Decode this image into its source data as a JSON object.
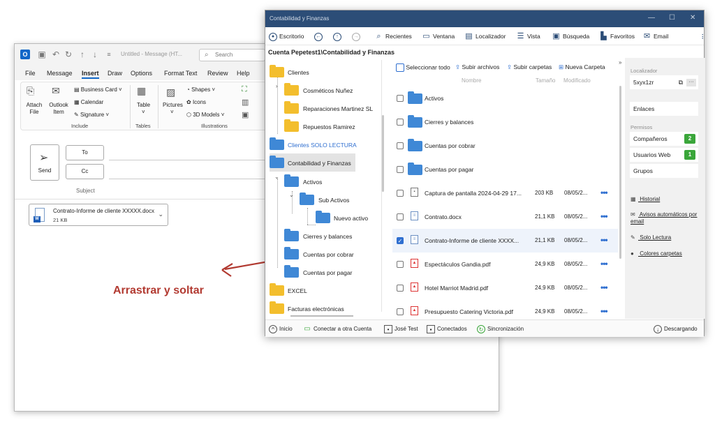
{
  "outlook": {
    "doc_title": "Untitled - Message (HT...",
    "search_placeholder": "Search",
    "menu": [
      "File",
      "Message",
      "Insert",
      "Draw",
      "Options",
      "Format Text",
      "Review",
      "Help"
    ],
    "ribbon": {
      "attach_file": "Attach File",
      "outlook_item": "Outlook Item",
      "business_card": "Business Card",
      "calendar": "Calendar",
      "signature": "Signature",
      "group_include": "Include",
      "table": "Table",
      "group_tables": "Tables",
      "pictures": "Pictures",
      "shapes": "Shapes",
      "icons": "Icons",
      "models_3d": "3D Models",
      "group_illustrations": "Illustrations"
    },
    "send": "Send",
    "to": "To",
    "cc": "Cc",
    "subject": "Subject",
    "attachment": {
      "name": "Contrato-Informe de cliente XXXXX.docx",
      "size": "21 KB"
    }
  },
  "drag_label": "Arrastrar y soltar",
  "app": {
    "title": "Contabilidad y Finanzas",
    "toolbar": {
      "escritorio": "Escritorio",
      "recientes": "Recientes",
      "ventana": "Ventana",
      "localizador": "Localizador",
      "vista": "Vista",
      "busqueda": "Búsqueda",
      "favoritos": "Favoritos",
      "email": "Email"
    },
    "path": "Cuenta Pepetest1\\Contabilidad y Finanzas",
    "tree": [
      {
        "label": "Clientes",
        "color": "yellow"
      },
      {
        "label": "Cosméticos Nuñez",
        "color": "yellow"
      },
      {
        "label": "Reparaciones Martinez SL",
        "color": "yellow"
      },
      {
        "label": "Repuestos Ramirez",
        "color": "yellow"
      },
      {
        "label": "Clientes SOLO LECTURA",
        "color": "blue"
      },
      {
        "label": "Contabilidad y Finanzas",
        "color": "blue"
      },
      {
        "label": "Activos",
        "color": "blue"
      },
      {
        "label": "Sub Activos",
        "color": "blue"
      },
      {
        "label": "Nuevo activo",
        "color": "blue"
      },
      {
        "label": "Cierres y balances",
        "color": "blue"
      },
      {
        "label": "Cuentas por cobrar",
        "color": "blue"
      },
      {
        "label": "Cuentas por pagar",
        "color": "blue"
      },
      {
        "label": "EXCEL",
        "color": "yellow"
      },
      {
        "label": "Facturas electrónicas",
        "color": "yellow"
      }
    ],
    "list_actions": {
      "select_all": "Seleccionar todo",
      "upload_files": "Subir archivos",
      "upload_folders": "Subir carpetas",
      "new_folder": "Nueva Carpeta"
    },
    "columns": {
      "name": "Nombre",
      "size": "Tamaño",
      "modified": "Modificado"
    },
    "files": [
      {
        "name": "Activos",
        "type": "folder",
        "size": "",
        "modified": ""
      },
      {
        "name": "Cierres y balances",
        "type": "folder",
        "size": "",
        "modified": ""
      },
      {
        "name": "Cuentas por cobrar",
        "type": "folder",
        "size": "",
        "modified": ""
      },
      {
        "name": "Cuentas por pagar",
        "type": "folder",
        "size": "",
        "modified": ""
      },
      {
        "name": "Captura de pantalla 2024-04-29 17...",
        "type": "img",
        "size": "203 KB",
        "modified": "08/05/2..."
      },
      {
        "name": "Contrato.docx",
        "type": "doc",
        "size": "21,1 KB",
        "modified": "08/05/2..."
      },
      {
        "name": "Contrato-Informe de cliente XXXX...",
        "type": "doc",
        "size": "21,1 KB",
        "modified": "08/05/2...",
        "selected": true
      },
      {
        "name": "Espectáculos Gandia.pdf",
        "type": "pdf",
        "size": "24,9 KB",
        "modified": "08/05/2..."
      },
      {
        "name": "Hotel Marriot Madrid.pdf",
        "type": "pdf",
        "size": "24,9 KB",
        "modified": "08/05/2..."
      },
      {
        "name": "Presupuesto Catering Victoria.pdf",
        "type": "pdf",
        "size": "24,9 KB",
        "modified": "08/05/2..."
      }
    ],
    "panel": {
      "localizador_label": "Localizador",
      "localizador_value": "5xyx1zr",
      "enlaces": "Enlaces",
      "permisos_label": "Permisos",
      "companeros": "Compañeros",
      "companeros_count": "2",
      "usuarios_web": "Usuarios Web",
      "usuarios_web_count": "1",
      "grupos": "Grupos",
      "historial": "Historial",
      "avisos": "Avisos automáticos por email",
      "solo_lectura": "Solo Lectura",
      "colores": "Colores carpetas"
    },
    "status": {
      "inicio": "Inicio",
      "conectar": "Conectar a otra Cuenta",
      "usuario": "José Test",
      "conectados": "Conectados",
      "sincronizacion": "Sincronización",
      "descargando": "Descargando"
    },
    "colors": {
      "titlebar": "#2c4d77",
      "accent": "#2f6fd0",
      "badge": "#3aa63a",
      "folder_yellow": "#f3be2d",
      "folder_blue": "#3f88d6"
    }
  }
}
